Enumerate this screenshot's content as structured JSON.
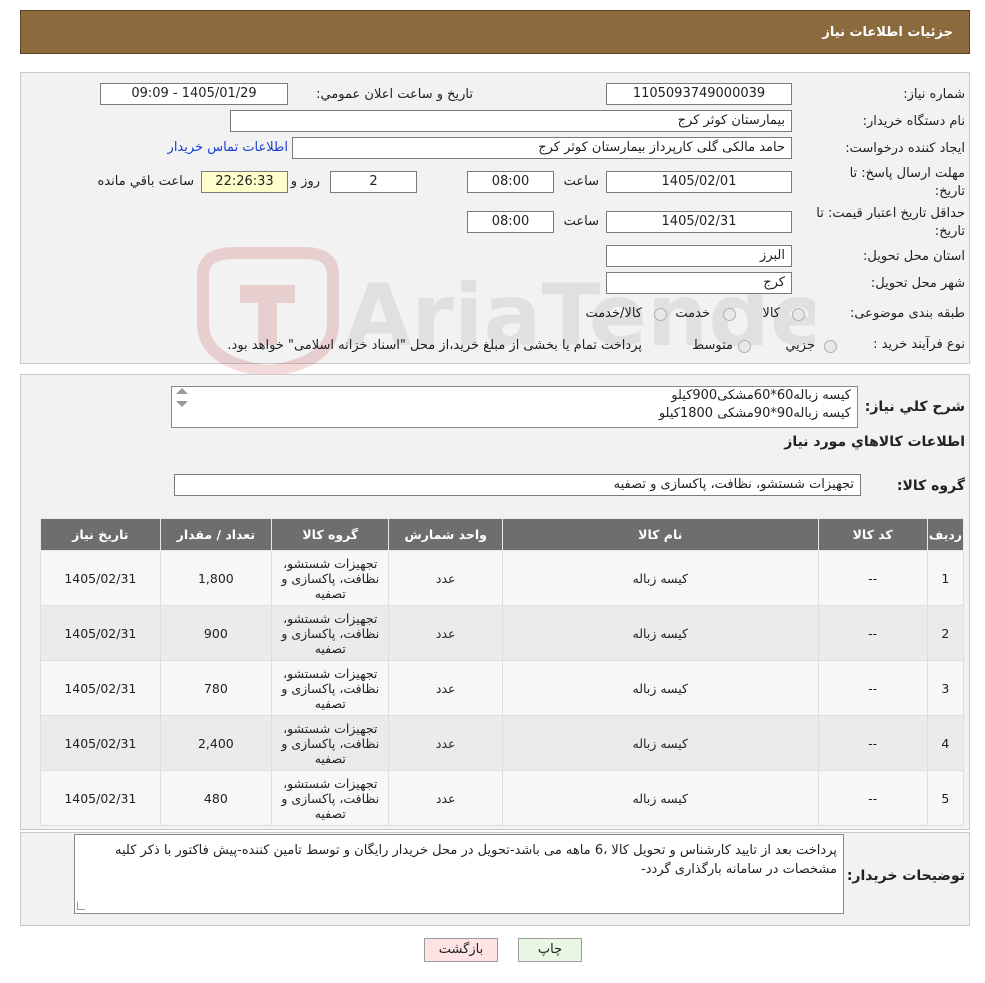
{
  "header": {
    "title": "جزئيات اطلاعات نياز"
  },
  "form": {
    "need_number": {
      "label": "شماره نياز:",
      "value": "1105093749000039"
    },
    "announce_datetime": {
      "label": "تاريخ و ساعت اعلان عمومي:",
      "value": "1405/01/29 - 09:09"
    },
    "buyer_org": {
      "label": "نام دستگاه خريدار:",
      "value": "بيمارستان کوثر کرج"
    },
    "requester": {
      "label": "ايجاد کننده درخواست:",
      "value": "حامد مالکی گلی کارپرداز بیمارستان کوثر کرج",
      "contact_link": "اطلاعات تماس خريدار"
    },
    "reply_deadline": {
      "label_line1": "مهلت ارسال پاسخ: تا",
      "label_line2": "تاريخ:",
      "date": "1405/02/01",
      "time_label": "ساعت",
      "time": "08:00",
      "days": "2",
      "days_label": "روز و",
      "remaining": "22:26:33",
      "remaining_label": "ساعت باقي مانده"
    },
    "price_validity": {
      "label_line1": "حداقل تاريخ اعتبار قيمت: تا",
      "label_line2": "تاريخ:",
      "date": "1405/02/31",
      "time_label": "ساعت",
      "time": "08:00"
    },
    "province": {
      "label": "استان محل تحويل:",
      "value": "البرز"
    },
    "city": {
      "label": "شهر محل تحويل:",
      "value": "کرج"
    },
    "category": {
      "label": "طبقه بندی موضوعی:",
      "options": [
        "کالا",
        "خدمت",
        "کالا/خدمت"
      ]
    },
    "process_type": {
      "label": "نوع فرآيند خريد :",
      "options": [
        "جزيي",
        "متوسط"
      ],
      "note": "پرداخت تمام يا بخشی از مبلغ خريد،از محل \"اسناد خزانه اسلامی\" خواهد بود."
    }
  },
  "watermark": {
    "text": "AriaTender.neT"
  },
  "summary": {
    "label": "شرح کلي نياز:",
    "lines": [
      "کيسه زباله60*60مشکی900کيلو",
      "کيسه زباله90*90مشکی 1800کيلو"
    ],
    "goods_info_title": "اطلاعات کالاهاي مورد نياز",
    "group_label": "گروه کالا:",
    "group_value": "تجهيزات شستشو، نظافت، پاکسازی و تصفيه"
  },
  "table": {
    "headers": [
      "رديف",
      "کد کالا",
      "نام کالا",
      "واحد شمارش",
      "گروه کالا",
      "تعداد / مقدار",
      "تاريخ نياز"
    ],
    "rows": [
      {
        "idx": "1",
        "code": "--",
        "name": "کيسه زباله",
        "unit": "عدد",
        "group": "تجهيزات شستشو، نظافت، پاکسازی و تصفيه",
        "qty": "1,800",
        "date": "1405/02/31"
      },
      {
        "idx": "2",
        "code": "--",
        "name": "کيسه زباله",
        "unit": "عدد",
        "group": "تجهيزات شستشو، نظافت، پاکسازی و تصفيه",
        "qty": "900",
        "date": "1405/02/31"
      },
      {
        "idx": "3",
        "code": "--",
        "name": "کيسه زباله",
        "unit": "عدد",
        "group": "تجهيزات شستشو، نظافت، پاکسازی و تصفيه",
        "qty": "780",
        "date": "1405/02/31"
      },
      {
        "idx": "4",
        "code": "--",
        "name": "کيسه زباله",
        "unit": "عدد",
        "group": "تجهيزات شستشو، نظافت، پاکسازی و تصفيه",
        "qty": "2,400",
        "date": "1405/02/31"
      },
      {
        "idx": "5",
        "code": "--",
        "name": "کيسه زباله",
        "unit": "عدد",
        "group": "تجهيزات شستشو، نظافت، پاکسازی و تصفيه",
        "qty": "480",
        "date": "1405/02/31"
      }
    ]
  },
  "buyer_notes": {
    "label": "توضيحات خريدار:",
    "text": "پرداخت بعد از تایید کارشناس و تحویل کالا ،6 ماهه می باشد-تحویل در محل خریدار رایگان و توسط تامین کننده-پیش فاکتور با ذکر کلیه مشخصات در سامانه بارگذاری گردد-"
  },
  "buttons": {
    "print": "چاپ",
    "back": "بازگشت"
  },
  "colors": {
    "header": "#8b6a3e",
    "table_header": "#6e6e6e",
    "back_button": "#fde3e3",
    "print_button": "#eaf6e4",
    "remaining_box": "#ffffcc"
  }
}
